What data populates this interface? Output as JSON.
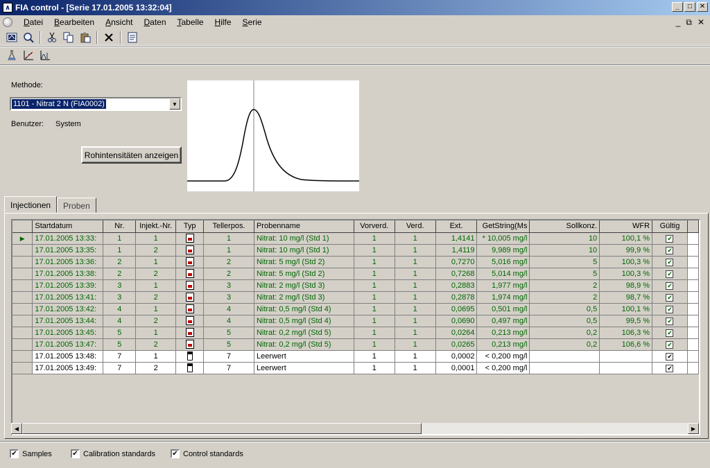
{
  "window": {
    "title": "FIA control - [Serie 17.01.2005 13:32:04]",
    "app_icon_glyph": "∧",
    "minimize": "_",
    "maximize": "□",
    "close": "✕"
  },
  "menu": {
    "items": [
      {
        "label": "Datei",
        "accel": "D"
      },
      {
        "label": "Bearbeiten",
        "accel": "B"
      },
      {
        "label": "Ansicht",
        "accel": "A"
      },
      {
        "label": "Daten",
        "accel": "D"
      },
      {
        "label": "Tabelle",
        "accel": "T"
      },
      {
        "label": "Hilfe",
        "accel": "H"
      },
      {
        "label": "Serie",
        "accel": "S"
      }
    ],
    "mdi_minimize": "_",
    "mdi_restore": "⧉",
    "mdi_close": "✕"
  },
  "toolbar_icons": [
    "report-icon",
    "preview-icon",
    "cut-icon",
    "copy-icon",
    "paste-icon",
    "delete-icon",
    "properties-icon"
  ],
  "toolbar2_icons": [
    "flask-icon",
    "calibration-chart-icon",
    "peak-chart-icon"
  ],
  "method": {
    "label": "Methode:",
    "selected": "1101 - Nitrat 2  N (FIA0002)",
    "user_label": "Benutzer:",
    "user_value": "System",
    "raw_button": "Rohintensitäten anzeigen"
  },
  "peak_preview": {
    "description_free": true,
    "accent": "#000000",
    "marker_color": "#808080"
  },
  "tabs": [
    "Injectionen",
    "Proben"
  ],
  "table": {
    "columns": [
      "Startdatum",
      "Nr.",
      "Injekt.-Nr.",
      "Typ",
      "Tellerpos.",
      "Probenname",
      "Vorverd.",
      "Verd.",
      "Ext.",
      "GetString(Ms",
      "Sollkonz.",
      "WFR",
      "Gültig"
    ],
    "rows": [
      {
        "date": "17.01.2005 13:33:",
        "nr": "1",
        "inj": "1",
        "type": "standard",
        "pos": "1",
        "name": "Nitrat: 10 mg/l (Std 1)",
        "vorverd": "1",
        "verd": "1",
        "ext": "1,4141",
        "getstring": "* 10,005 mg/l",
        "soll": "10",
        "wfr": "100,1 %",
        "valid": true,
        "current": true
      },
      {
        "date": "17.01.2005 13:35:",
        "nr": "1",
        "inj": "2",
        "type": "standard",
        "pos": "1",
        "name": "Nitrat: 10 mg/l (Std 1)",
        "vorverd": "1",
        "verd": "1",
        "ext": "1,4119",
        "getstring": "9,989 mg/l",
        "soll": "10",
        "wfr": "99,9 %",
        "valid": true
      },
      {
        "date": "17.01.2005 13:36:",
        "nr": "2",
        "inj": "1",
        "type": "standard",
        "pos": "2",
        "name": "Nitrat: 5 mg/l (Std 2)",
        "vorverd": "1",
        "verd": "1",
        "ext": "0,7270",
        "getstring": "5,016 mg/l",
        "soll": "5",
        "wfr": "100,3 %",
        "valid": true
      },
      {
        "date": "17.01.2005 13:38:",
        "nr": "2",
        "inj": "2",
        "type": "standard",
        "pos": "2",
        "name": "Nitrat: 5 mg/l (Std 2)",
        "vorverd": "1",
        "verd": "1",
        "ext": "0,7268",
        "getstring": "5,014 mg/l",
        "soll": "5",
        "wfr": "100,3 %",
        "valid": true
      },
      {
        "date": "17.01.2005 13:39:",
        "nr": "3",
        "inj": "1",
        "type": "standard",
        "pos": "3",
        "name": "Nitrat: 2 mg/l (Std 3)",
        "vorverd": "1",
        "verd": "1",
        "ext": "0,2883",
        "getstring": "1,977 mg/l",
        "soll": "2",
        "wfr": "98,9 %",
        "valid": true
      },
      {
        "date": "17.01.2005 13:41:",
        "nr": "3",
        "inj": "2",
        "type": "standard",
        "pos": "3",
        "name": "Nitrat: 2 mg/l (Std 3)",
        "vorverd": "1",
        "verd": "1",
        "ext": "0,2878",
        "getstring": "1,974 mg/l",
        "soll": "2",
        "wfr": "98,7 %",
        "valid": true
      },
      {
        "date": "17.01.2005 13:42:",
        "nr": "4",
        "inj": "1",
        "type": "standard",
        "pos": "4",
        "name": "Nitrat: 0,5 mg/l (Std 4)",
        "vorverd": "1",
        "verd": "1",
        "ext": "0,0695",
        "getstring": "0,501 mg/l",
        "soll": "0,5",
        "wfr": "100,1 %",
        "valid": true
      },
      {
        "date": "17.01.2005 13:44:",
        "nr": "4",
        "inj": "2",
        "type": "standard",
        "pos": "4",
        "name": "Nitrat: 0,5 mg/l (Std 4)",
        "vorverd": "1",
        "verd": "1",
        "ext": "0,0690",
        "getstring": "0,497 mg/l",
        "soll": "0,5",
        "wfr": "99,5 %",
        "valid": true
      },
      {
        "date": "17.01.2005 13:45:",
        "nr": "5",
        "inj": "1",
        "type": "standard",
        "pos": "5",
        "name": "Nitrat: 0,2 mg/l (Std 5)",
        "vorverd": "1",
        "verd": "1",
        "ext": "0,0264",
        "getstring": "0,213 mg/l",
        "soll": "0,2",
        "wfr": "106,3 %",
        "valid": true
      },
      {
        "date": "17.01.2005 13:47:",
        "nr": "5",
        "inj": "2",
        "type": "standard",
        "pos": "5",
        "name": "Nitrat: 0,2 mg/l (Std 5)",
        "vorverd": "1",
        "verd": "1",
        "ext": "0,0265",
        "getstring": "0,213 mg/l",
        "soll": "0,2",
        "wfr": "106,6 %",
        "valid": true
      },
      {
        "date": "17.01.2005 13:48:",
        "nr": "7",
        "inj": "1",
        "type": "blank",
        "pos": "7",
        "name": "Leerwert",
        "vorverd": "1",
        "verd": "1",
        "ext": "0,0002",
        "getstring": "< 0,200 mg/l",
        "soll": "",
        "wfr": "",
        "valid": true
      },
      {
        "date": "17.01.2005 13:49:",
        "nr": "7",
        "inj": "2",
        "type": "blank",
        "pos": "7",
        "name": "Leerwert",
        "vorverd": "1",
        "verd": "1",
        "ext": "0,0001",
        "getstring": "< 0,200 mg/l",
        "soll": "",
        "wfr": "",
        "valid": true
      }
    ],
    "standard_text_color": "#006600"
  },
  "filters": [
    {
      "label": "Samples",
      "checked": true
    },
    {
      "label": "Calibration standards",
      "checked": true
    },
    {
      "label": "Control standards",
      "checked": true
    }
  ],
  "check_glyph": "✔"
}
